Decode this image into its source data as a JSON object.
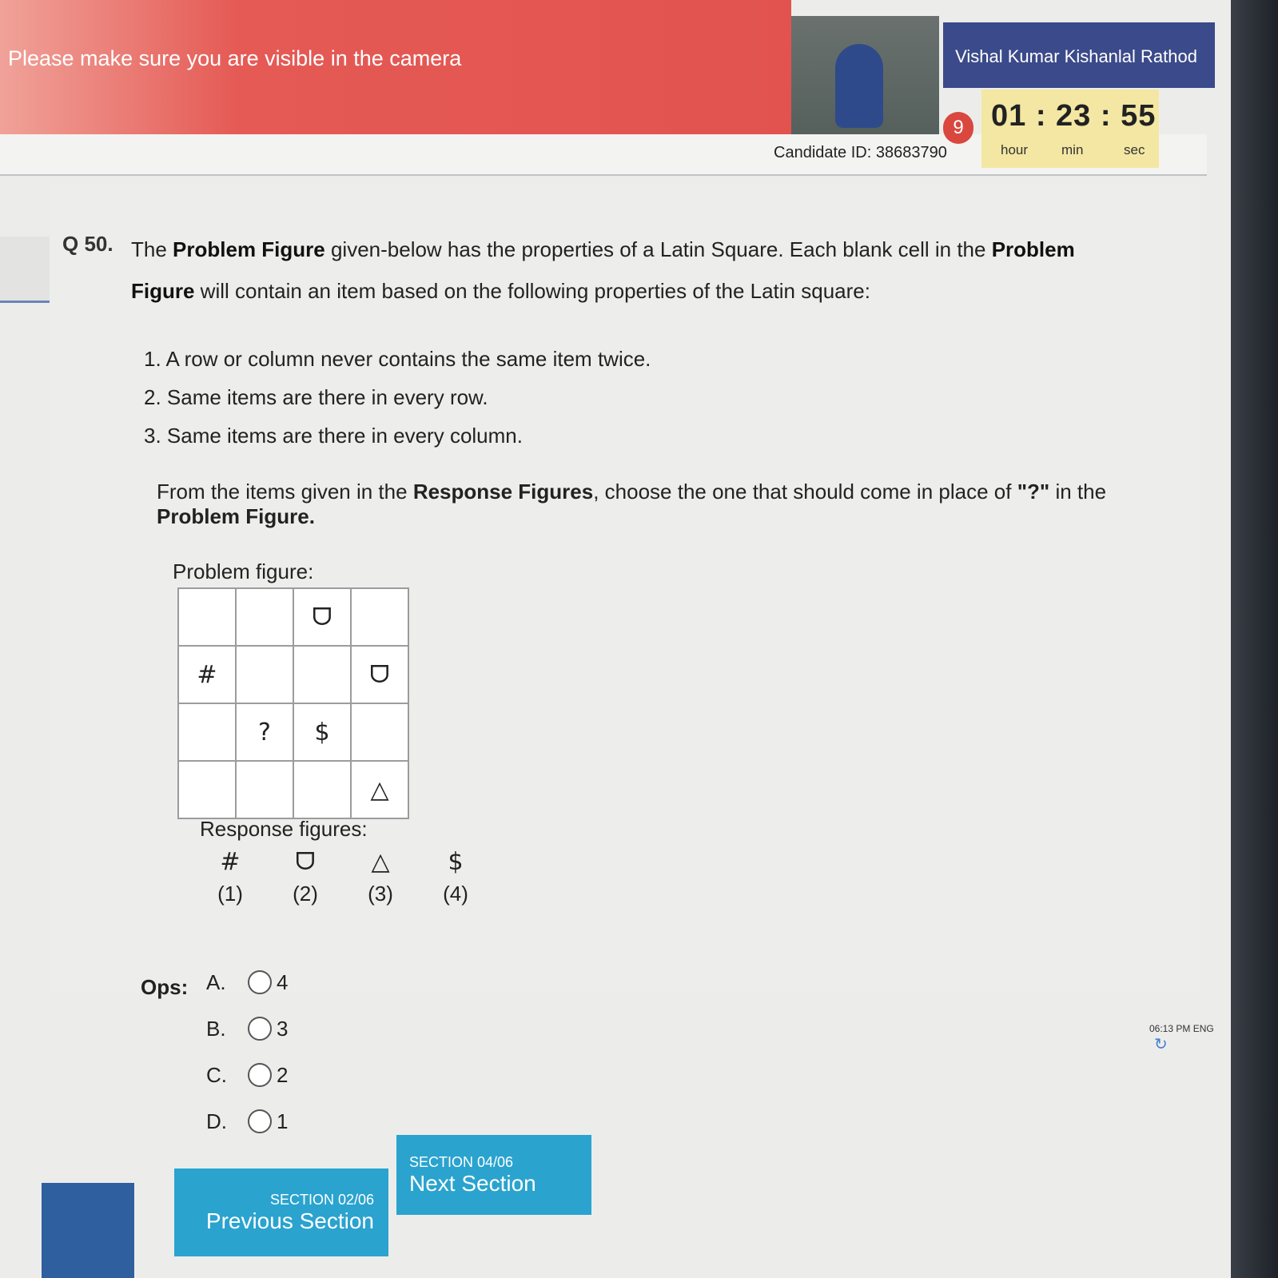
{
  "header": {
    "camera_notice": "Please make sure you are visible in the camera",
    "user_name": "Vishal Kumar Kishanlal Rathod",
    "candidate_id": "Candidate ID: 38683790",
    "badge_number": "9"
  },
  "timer": {
    "value": "01 : 23 : 55",
    "units": [
      "hour",
      "min",
      "sec"
    ]
  },
  "question": {
    "number": "Q 50.",
    "text_1": "The ",
    "bold_1": "Problem Figure",
    "text_2": " given-below has the properties of a Latin Square. Each blank cell in the ",
    "bold_2": "Problem Figure",
    "text_3": " will contain an item based on the following properties of the Latin square:",
    "rules": [
      "1. A row or column never contains the same item twice.",
      "2. Same items are there in every row.",
      "3. Same items are there in every column."
    ],
    "instr_1": "From the items given in the ",
    "instr_bold_1": "Response Figures",
    "instr_2": ", choose the one that should come in place of ",
    "instr_bold_2": "\"?\"",
    "instr_3": " in the ",
    "instr_bold_3": "Problem Figure.",
    "problem_label": "Problem figure:",
    "grid": [
      [
        "",
        "",
        "ᗜ",
        ""
      ],
      [
        "#",
        "",
        "",
        "ᗜ"
      ],
      [
        "",
        "?",
        "$",
        ""
      ],
      [
        "",
        "",
        "",
        "△"
      ]
    ],
    "response_label": "Response figures:",
    "responses": [
      {
        "symbol": "#",
        "num": "(1)"
      },
      {
        "symbol": "ᗜ",
        "num": "(2)"
      },
      {
        "symbol": "△",
        "num": "(3)"
      },
      {
        "symbol": "$",
        "num": "(4)"
      }
    ],
    "ops_label": "Ops:",
    "options": [
      {
        "letter": "A.",
        "value": "4"
      },
      {
        "letter": "B.",
        "value": "3"
      },
      {
        "letter": "C.",
        "value": "2"
      },
      {
        "letter": "D.",
        "value": "1"
      }
    ]
  },
  "navigation": {
    "prev_section": "SECTION 02/06",
    "prev_label": "Previous Section",
    "next_section": "SECTION 04/06",
    "next_label": "Next Section"
  },
  "taskbar": {
    "time": "06:13 PM",
    "lang": "ENG"
  }
}
